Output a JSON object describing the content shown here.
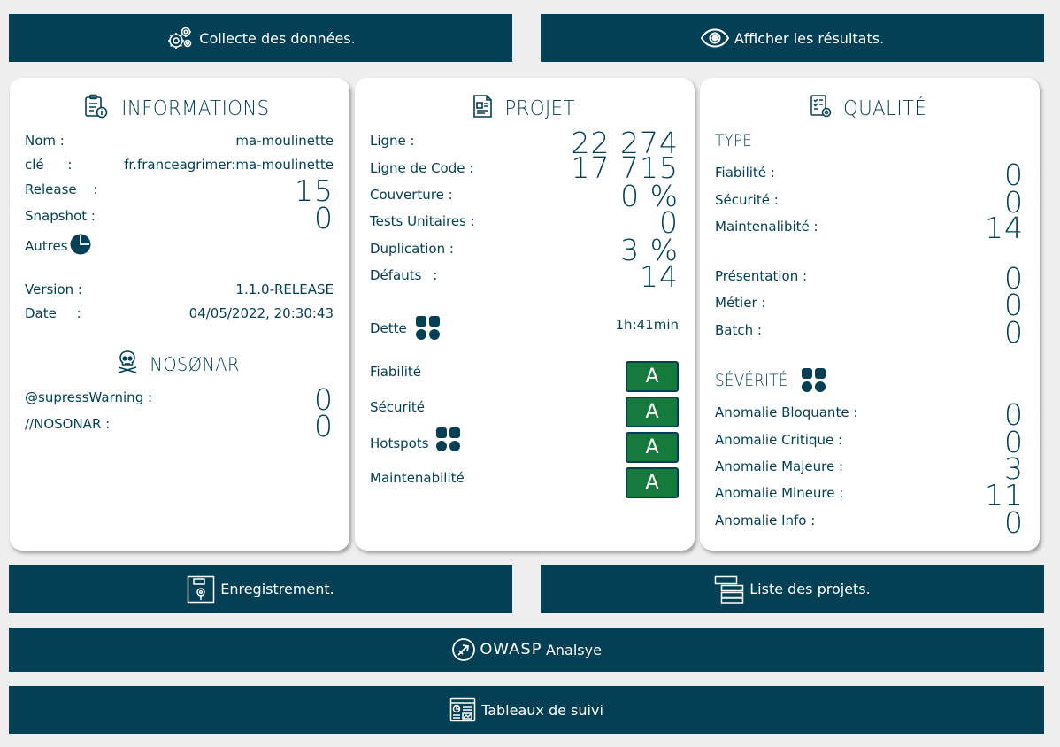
{
  "top_buttons": {
    "collect": "Collecte des données.",
    "results": "Afficher les résultats."
  },
  "informations": {
    "title": "INFORMATIONS",
    "nom_label": "Nom :",
    "nom_value": "ma-moulinette",
    "cle_label": "clé :",
    "cle_value": "fr.franceagrimer:ma-moulinette",
    "release_label": "Release :",
    "release_value": "15",
    "snapshot_label": "Snapshot :",
    "snapshot_value": "0",
    "autres_label": "Autres",
    "version_label": "Version :",
    "version_value": "1.1.0-RELEASE",
    "date_label": "Date :",
    "date_value": "04/05/2022, 20:30:43",
    "nosonar_title": "NOSØNAR",
    "supress_label": "@supressWarning :",
    "supress_value": "0",
    "nosonar_label": "//NOSONAR :",
    "nosonar_value": "0"
  },
  "projet": {
    "title": "PROJET",
    "ligne_label": "Ligne :",
    "ligne_value": "22 274",
    "code_label": "Ligne de Code :",
    "code_value": "17 715",
    "couverture_label": "Couverture :",
    "couverture_value": "0 %",
    "tests_label": "Tests Unitaires :",
    "tests_value": "0",
    "duplication_label": "Duplication :",
    "duplication_value": "3 %",
    "defauts_label": "Défauts :",
    "defauts_value": "14",
    "dette_label": "Dette",
    "dette_value": "1h:41min",
    "fiabilite_label": "Fiabilité",
    "fiabilite_grade": "A",
    "securite_label": "Sécurité",
    "securite_grade": "A",
    "hotspots_label": "Hotspots",
    "hotspots_grade": "A",
    "maint_label": "Maintenabilité",
    "maint_grade": "A"
  },
  "qualite": {
    "title": "QUALITÉ",
    "type_title": "TYPE",
    "fiabilite_label": "Fiabilité :",
    "fiabilite_value": "0",
    "securite_label": "Sécurité :",
    "securite_value": "0",
    "maint_label": "Maintenalibité :",
    "maint_value": "14",
    "presentation_label": "Présentation :",
    "presentation_value": "0",
    "metier_label": "Métier :",
    "metier_value": "0",
    "batch_label": "Batch :",
    "batch_value": "0",
    "severite_title": "SÉVÉRITÉ",
    "bloquante_label": "Anomalie Bloquante :",
    "bloquante_value": "0",
    "critique_label": "Anomalie Critique :",
    "critique_value": "0",
    "majeure_label": "Anomalie Majeure :",
    "majeure_value": "3",
    "mineure_label": "Anomalie Mineure :",
    "mineure_value": "11",
    "info_label": "Anomalie Info :",
    "info_value": "0"
  },
  "bottom_buttons": {
    "save": "Enregistrement.",
    "projects": "Liste des projets.",
    "owasp_logo": "OWASP",
    "owasp": "Analsye",
    "dashboards": "Tableaux de suivi"
  },
  "colors": {
    "primary": "#044055",
    "grade_a": "#177a3d",
    "background": "#eeeeee"
  }
}
